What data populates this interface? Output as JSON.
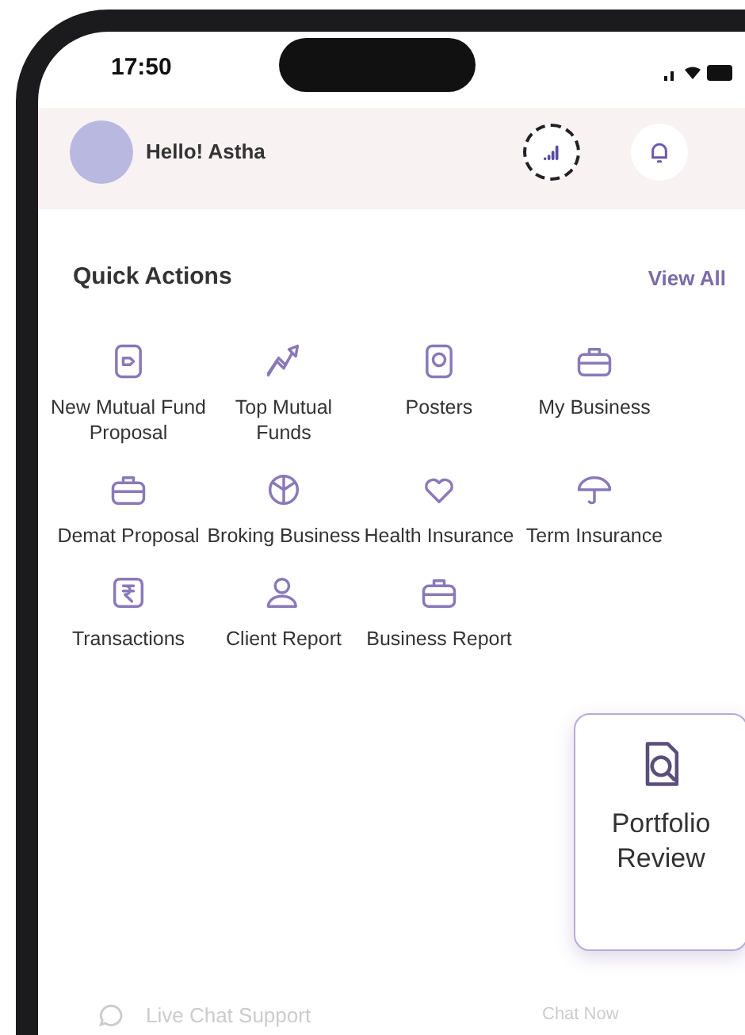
{
  "status_bar": {
    "time": "17:50"
  },
  "header": {
    "greeting": "Hello! Astha"
  },
  "quick_actions": {
    "title": "Quick Actions",
    "view_all": "View All",
    "items": [
      {
        "label": "New Mutual Fund Proposal"
      },
      {
        "label": "Top Mutual Funds"
      },
      {
        "label": "Posters"
      },
      {
        "label": "My Business"
      },
      {
        "label": "Demat Proposal"
      },
      {
        "label": "Broking Business"
      },
      {
        "label": "Health Insurance"
      },
      {
        "label": "Term Insurance"
      },
      {
        "label": "Transactions"
      },
      {
        "label": "Client Report"
      },
      {
        "label": "Business Report"
      }
    ]
  },
  "highlight_card": {
    "label": "Portfolio Review"
  },
  "support_bar": {
    "label": "Live Chat Support",
    "action": "Chat Now"
  }
}
